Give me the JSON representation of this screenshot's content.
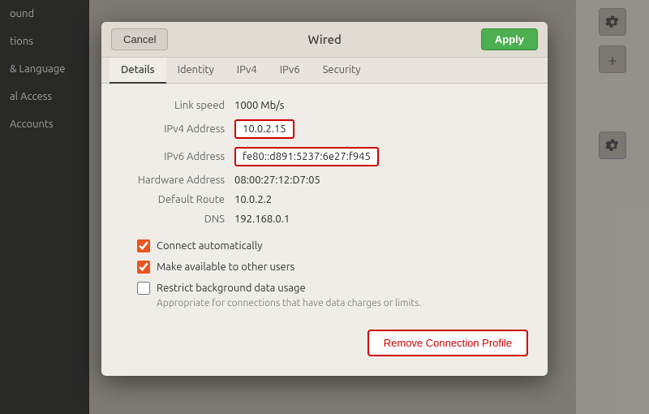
{
  "sidebar": {
    "items": [
      {
        "label": "ound",
        "active": false
      },
      {
        "label": "tions",
        "active": false
      },
      {
        "label": "& Language",
        "active": false
      },
      {
        "label": "al Access",
        "active": false
      },
      {
        "label": "Accounts",
        "active": false
      }
    ]
  },
  "dialog": {
    "title": "Wired",
    "cancel_label": "Cancel",
    "apply_label": "Apply",
    "tabs": [
      {
        "label": "Details",
        "active": true
      },
      {
        "label": "Identity",
        "active": false
      },
      {
        "label": "IPv4",
        "active": false
      },
      {
        "label": "IPv6",
        "active": false
      },
      {
        "label": "Security",
        "active": false
      }
    ],
    "details": {
      "link_speed_label": "Link speed",
      "link_speed_value": "1000 Mb/s",
      "ipv4_label": "IPv4 Address",
      "ipv4_value": "10.0.2.15",
      "ipv6_label": "IPv6 Address",
      "ipv6_value": "fe80::d891:5237:6e27:f945",
      "hardware_label": "Hardware Address",
      "hardware_value": "08:00:27:12:D7:05",
      "default_route_label": "Default Route",
      "default_route_value": "10.0.2.2",
      "dns_label": "DNS",
      "dns_value": "192.168.0.1",
      "connect_auto_label": "Connect automatically",
      "make_available_label": "Make available to other users",
      "restrict_label": "Restrict background data usage",
      "restrict_sub": "Appropriate for connections that have data charges or limits."
    },
    "remove_label": "Remove Connection Profile"
  }
}
